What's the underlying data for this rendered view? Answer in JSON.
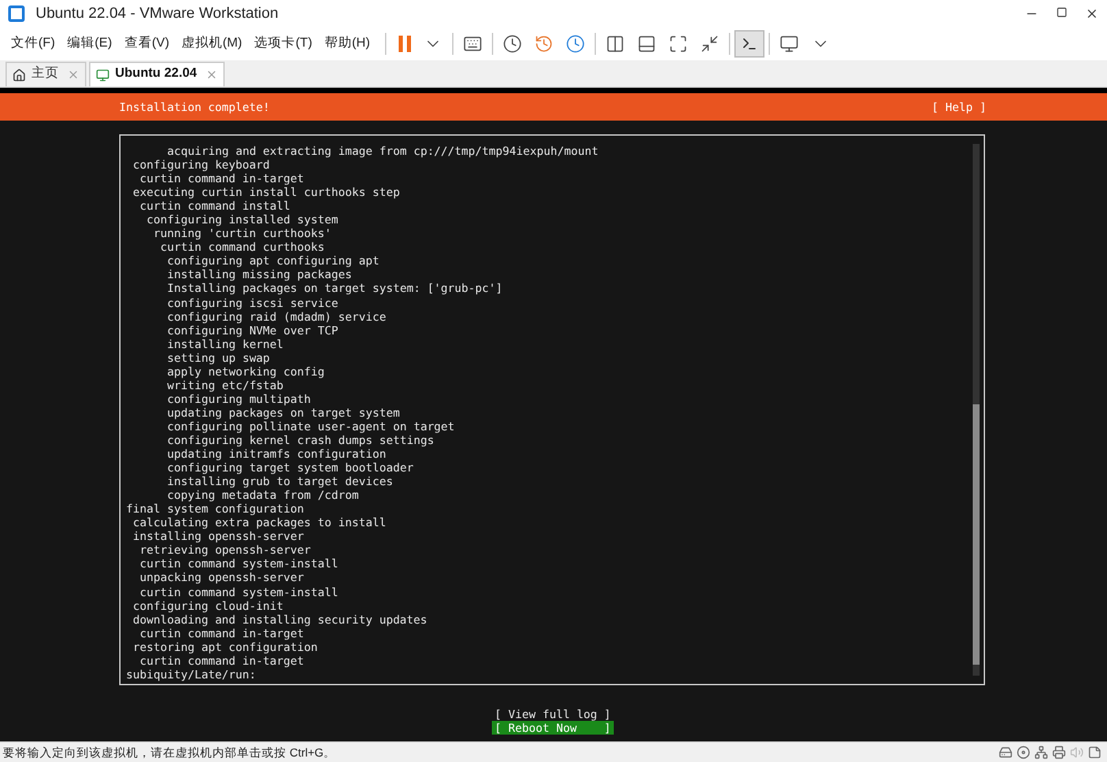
{
  "window": {
    "title": "Ubuntu 22.04 - VMware Workstation"
  },
  "menu": [
    "文件(F)",
    "编辑(E)",
    "查看(V)",
    "虚拟机(M)",
    "选项卡(T)",
    "帮助(H)"
  ],
  "tabs": [
    {
      "label": "主页",
      "kind": "home",
      "selected": false
    },
    {
      "label": "Ubuntu 22.04",
      "kind": "vm",
      "selected": true
    }
  ],
  "installer": {
    "title": "Installation complete!",
    "help": "[ Help ]",
    "log": [
      {
        "children": [
          {
            "children": [
              {
                "children": [
                  {
                    "children": [
                      {
                        "children": [
                          {
                            "children": [
                              {
                                "text": "acquiring and extracting image from cp:///tmp/tmp94iexpuh/mount"
                              }
                            ]
                          }
                        ]
                      }
                    ]
                  }
                ]
              }
            ]
          },
          {
            "text": "configuring keyboard",
            "children": [
              {
                "text": "curtin command in-target"
              }
            ]
          },
          {
            "text": "executing curtin install curthooks step",
            "children": [
              {
                "text": "curtin command install",
                "children": [
                  {
                    "text": "configuring installed system",
                    "children": [
                      {
                        "text": "running 'curtin curthooks'",
                        "children": [
                          {
                            "text": "curtin command curthooks",
                            "children": [
                              {
                                "text": "configuring apt configuring apt"
                              },
                              {
                                "text": "installing missing packages"
                              },
                              {
                                "text": "Installing packages on target system: ['grub-pc']"
                              },
                              {
                                "text": "configuring iscsi service"
                              },
                              {
                                "text": "configuring raid (mdadm) service"
                              },
                              {
                                "text": "configuring NVMe over TCP"
                              },
                              {
                                "text": "installing kernel"
                              },
                              {
                                "text": "setting up swap"
                              },
                              {
                                "text": "apply networking config"
                              },
                              {
                                "text": "writing etc/fstab"
                              },
                              {
                                "text": "configuring multipath"
                              },
                              {
                                "text": "updating packages on target system"
                              },
                              {
                                "text": "configuring pollinate user-agent on target"
                              },
                              {
                                "text": "configuring kernel crash dumps settings"
                              },
                              {
                                "text": "updating initramfs configuration"
                              },
                              {
                                "text": "configuring target system bootloader"
                              },
                              {
                                "text": "installing grub to target devices"
                              },
                              {
                                "text": "copying metadata from /cdrom"
                              }
                            ]
                          }
                        ]
                      }
                    ]
                  }
                ]
              }
            ]
          }
        ]
      },
      {
        "text": "final system configuration",
        "children": [
          {
            "text": "calculating extra packages to install"
          },
          {
            "text": "installing openssh-server",
            "children": [
              {
                "text": "retrieving openssh-server"
              },
              {
                "text": "curtin command system-install"
              },
              {
                "text": "unpacking openssh-server"
              },
              {
                "text": "curtin command system-install"
              }
            ]
          },
          {
            "text": "configuring cloud-init"
          },
          {
            "text": "downloading and installing security updates",
            "children": [
              {
                "text": "curtin command in-target"
              }
            ]
          },
          {
            "text": "restoring apt configuration",
            "children": [
              {
                "text": "curtin command in-target"
              }
            ]
          }
        ]
      },
      {
        "text": "subiquity/Late/run:"
      }
    ],
    "buttons": [
      {
        "label": "[ View full log ]",
        "selected": false
      },
      {
        "label": "[ Reboot Now    ]",
        "selected": true
      }
    ]
  },
  "status_bar": {
    "message": "要将输入定向到该虚拟机，请在虚拟机内部单击或按 Ctrl+G。"
  }
}
